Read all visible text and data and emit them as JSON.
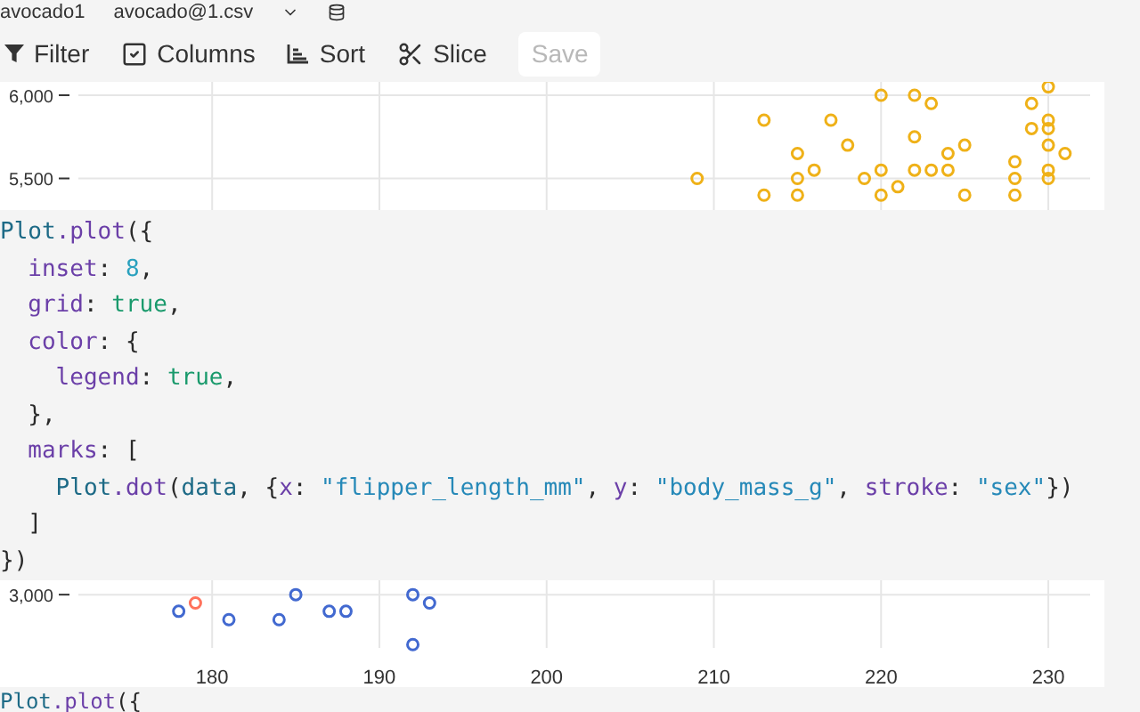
{
  "header": {
    "notebook": "avocado1",
    "file": "avocado@1.csv"
  },
  "toolbar": {
    "items": [
      {
        "kind": "filter",
        "label": "Filter"
      },
      {
        "kind": "columns",
        "label": "Columns"
      },
      {
        "kind": "sort",
        "label": "Sort"
      },
      {
        "kind": "slice",
        "label": "Slice"
      }
    ],
    "save": {
      "label": "Save",
      "disabled": true
    }
  },
  "chart": {
    "chart_data": {
      "type": "scatter",
      "grid": true,
      "xlim": [
        172,
        232.5
      ],
      "ylim": [
        2680,
        6080
      ],
      "xticks": [
        180,
        190,
        200,
        210,
        220,
        230
      ],
      "yticks": [
        {
          "value": 3000,
          "label": "3,000"
        },
        {
          "value": 5500,
          "label": "5,500"
        },
        {
          "value": 6000,
          "label": "6,000"
        }
      ],
      "series": [
        {
          "color": "#efb118",
          "x": [
            213,
            217,
            220,
            222,
            223,
            230,
            229,
            229,
            230,
            230,
            215,
            218,
            222,
            224,
            225,
            230,
            231,
            228,
            216,
            215,
            209,
            219,
            220,
            223,
            224,
            222,
            228,
            230,
            230,
            221,
            213,
            215,
            220,
            225,
            228
          ],
          "values": [
            5850,
            5850,
            6000,
            6000,
            5950,
            6050,
            5950,
            5800,
            5850,
            5800,
            5650,
            5700,
            5750,
            5650,
            5700,
            5700,
            5650,
            5600,
            5550,
            5500,
            5500,
            5500,
            5550,
            5550,
            5550,
            5550,
            5500,
            5550,
            5500,
            5450,
            5400,
            5400,
            5400,
            5400,
            5400
          ]
        },
        {
          "color": "#ff725c",
          "x": [
            179
          ],
          "values": [
            2950
          ]
        },
        {
          "color": "#4269d0",
          "x": [
            178,
            181,
            184,
            185,
            187,
            188,
            192,
            193,
            192
          ],
          "values": [
            2900,
            2850,
            2850,
            3000,
            2900,
            2900,
            3000,
            2950,
            2700
          ]
        }
      ]
    }
  },
  "code": {
    "lines": [
      [
        {
          "kind": "fn",
          "text": "Plot"
        },
        {
          "kind": "key",
          "text": ".plot"
        },
        {
          "kind": "plain",
          "text": "({"
        }
      ],
      [
        {
          "kind": "key",
          "text": "  inset"
        },
        {
          "kind": "plain",
          "text": ": "
        },
        {
          "kind": "num",
          "text": "8"
        },
        {
          "kind": "plain",
          "text": ","
        }
      ],
      [
        {
          "kind": "key",
          "text": "  grid"
        },
        {
          "kind": "plain",
          "text": ": "
        },
        {
          "kind": "bool",
          "text": "true"
        },
        {
          "kind": "plain",
          "text": ","
        }
      ],
      [
        {
          "kind": "key",
          "text": "  color"
        },
        {
          "kind": "plain",
          "text": ": {"
        }
      ],
      [
        {
          "kind": "key",
          "text": "    legend"
        },
        {
          "kind": "plain",
          "text": ": "
        },
        {
          "kind": "bool",
          "text": "true"
        },
        {
          "kind": "plain",
          "text": ","
        }
      ],
      [
        {
          "kind": "plain",
          "text": "  },"
        }
      ],
      [
        {
          "kind": "key",
          "text": "  marks"
        },
        {
          "kind": "plain",
          "text": ": ["
        }
      ],
      [
        {
          "kind": "fn",
          "text": "    Plot"
        },
        {
          "kind": "key",
          "text": ".dot"
        },
        {
          "kind": "plain",
          "text": "("
        },
        {
          "kind": "fn",
          "text": "data"
        },
        {
          "kind": "plain",
          "text": ", {"
        },
        {
          "kind": "key",
          "text": "x"
        },
        {
          "kind": "plain",
          "text": ": "
        },
        {
          "kind": "str",
          "text": "\"flipper_length_mm\""
        },
        {
          "kind": "plain",
          "text": ", "
        },
        {
          "kind": "key",
          "text": "y"
        },
        {
          "kind": "plain",
          "text": ": "
        },
        {
          "kind": "str",
          "text": "\"body_mass_g\""
        },
        {
          "kind": "plain",
          "text": ", "
        },
        {
          "kind": "key",
          "text": "stroke"
        },
        {
          "kind": "plain",
          "text": ": "
        },
        {
          "kind": "str",
          "text": "\"sex\""
        },
        {
          "kind": "plain",
          "text": "})"
        }
      ],
      [
        {
          "kind": "plain",
          "text": "  ]"
        }
      ],
      [
        {
          "kind": "plain",
          "text": "})"
        }
      ]
    ]
  },
  "next_code": {
    "lines": [
      [
        {
          "kind": "fn",
          "text": "Plot"
        },
        {
          "kind": "key",
          "text": ".plot"
        },
        {
          "kind": "plain",
          "text": "({"
        }
      ]
    ]
  }
}
